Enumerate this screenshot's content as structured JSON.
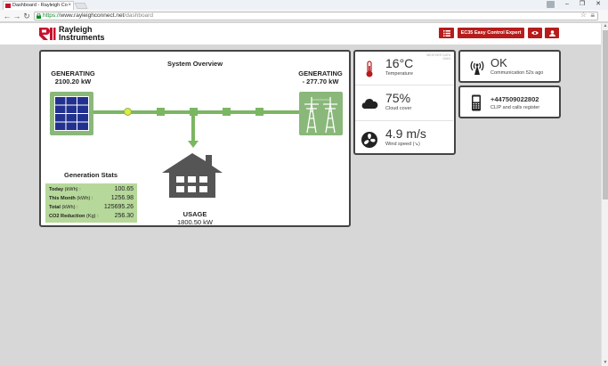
{
  "browser": {
    "tab_title": "Dashboard - Rayleigh Co",
    "url_scheme": "https://",
    "url_host": "www.rayleighconnect.net",
    "url_path": "/dashboard"
  },
  "brand": {
    "name_line1": "Rayleigh",
    "name_line2": "Instruments",
    "accent": "#b71c1c"
  },
  "header": {
    "device_button": "EC35 Easy Control Expert"
  },
  "overview": {
    "title": "System Overview",
    "solar_label": "GENERATING",
    "solar_value": "2100.20 kW",
    "grid_label": "GENERATING",
    "grid_value": "- 277.70 kW",
    "usage_label": "USAGE",
    "usage_value": "1800.50 kW",
    "stats_title": "Generation Stats",
    "stats": [
      {
        "label": "Today",
        "unit": "(kWh) :",
        "value": "100.65"
      },
      {
        "label": "This Month",
        "unit": "(kWh) :",
        "value": "1256.98"
      },
      {
        "label": "Total",
        "unit": "(kWh) :",
        "value": "125695.26"
      },
      {
        "label": "CO2 Reduction",
        "unit": "(Kg) :",
        "value": "256.30"
      }
    ],
    "line_color": "#7bb662"
  },
  "weather": {
    "source_note_1": "WEATHER DATA",
    "source_note_2": "SMHI",
    "temperature": "16°C",
    "temperature_label": "Temperature",
    "cloud": "75%",
    "cloud_label": "Cloud cover",
    "wind": "4.9 m/s",
    "wind_label": "Wind speed (↘)"
  },
  "status": {
    "value": "OK",
    "label": "Communication 52s ago"
  },
  "phone": {
    "number": "+447509022802",
    "label": "CLIP and calls register"
  }
}
